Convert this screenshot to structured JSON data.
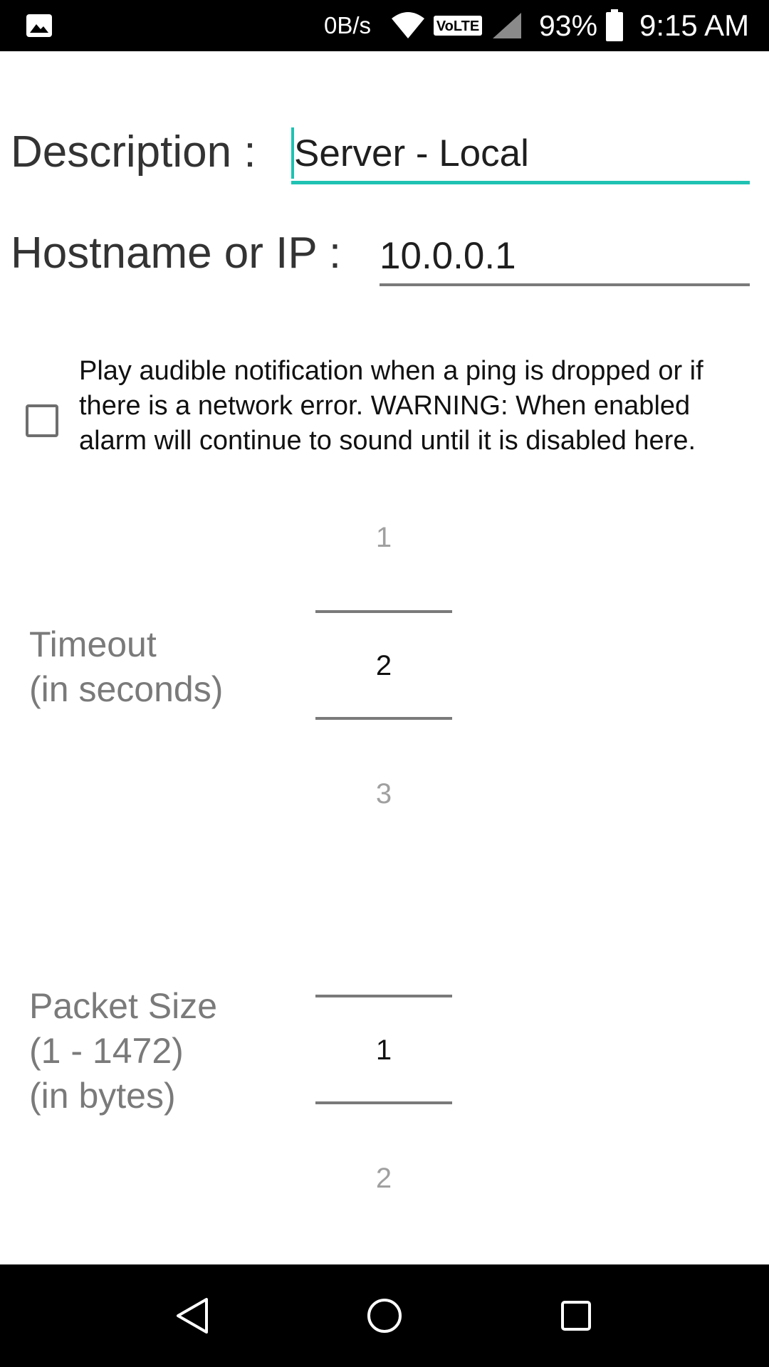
{
  "status_bar": {
    "net_speed": "0B/s",
    "volte": "VoLTE",
    "battery_percent": "93%",
    "battery_level": 0.93,
    "time": "9:15 AM",
    "icons": [
      "gallery-icon",
      "wifi-icon",
      "volte-icon",
      "signal-icon",
      "battery-icon"
    ]
  },
  "form": {
    "description_label": "Description :",
    "description_value": "Server - Local",
    "hostname_label": "Hostname or IP :",
    "hostname_value": "10.0.0.1",
    "alarm_checked": false,
    "alarm_text": "Play audible notification when a ping is dropped or if there is a network error. WARNING: When enabled alarm will continue to sound until it is disabled here."
  },
  "timeout_picker": {
    "label_line1": "Timeout",
    "label_line2": "(in seconds)",
    "prev": "1",
    "selected": "2",
    "next": "3"
  },
  "packet_picker": {
    "label_line1": "Packet Size",
    "label_line2": "(1 - 1472)",
    "label_line3": "(in bytes)",
    "selected": "1",
    "next": "2"
  },
  "colors": {
    "accent": "#1fc2b3",
    "bars": "#000000"
  },
  "nav_bar": {
    "icons": [
      "back-icon",
      "home-icon",
      "recents-icon"
    ]
  }
}
